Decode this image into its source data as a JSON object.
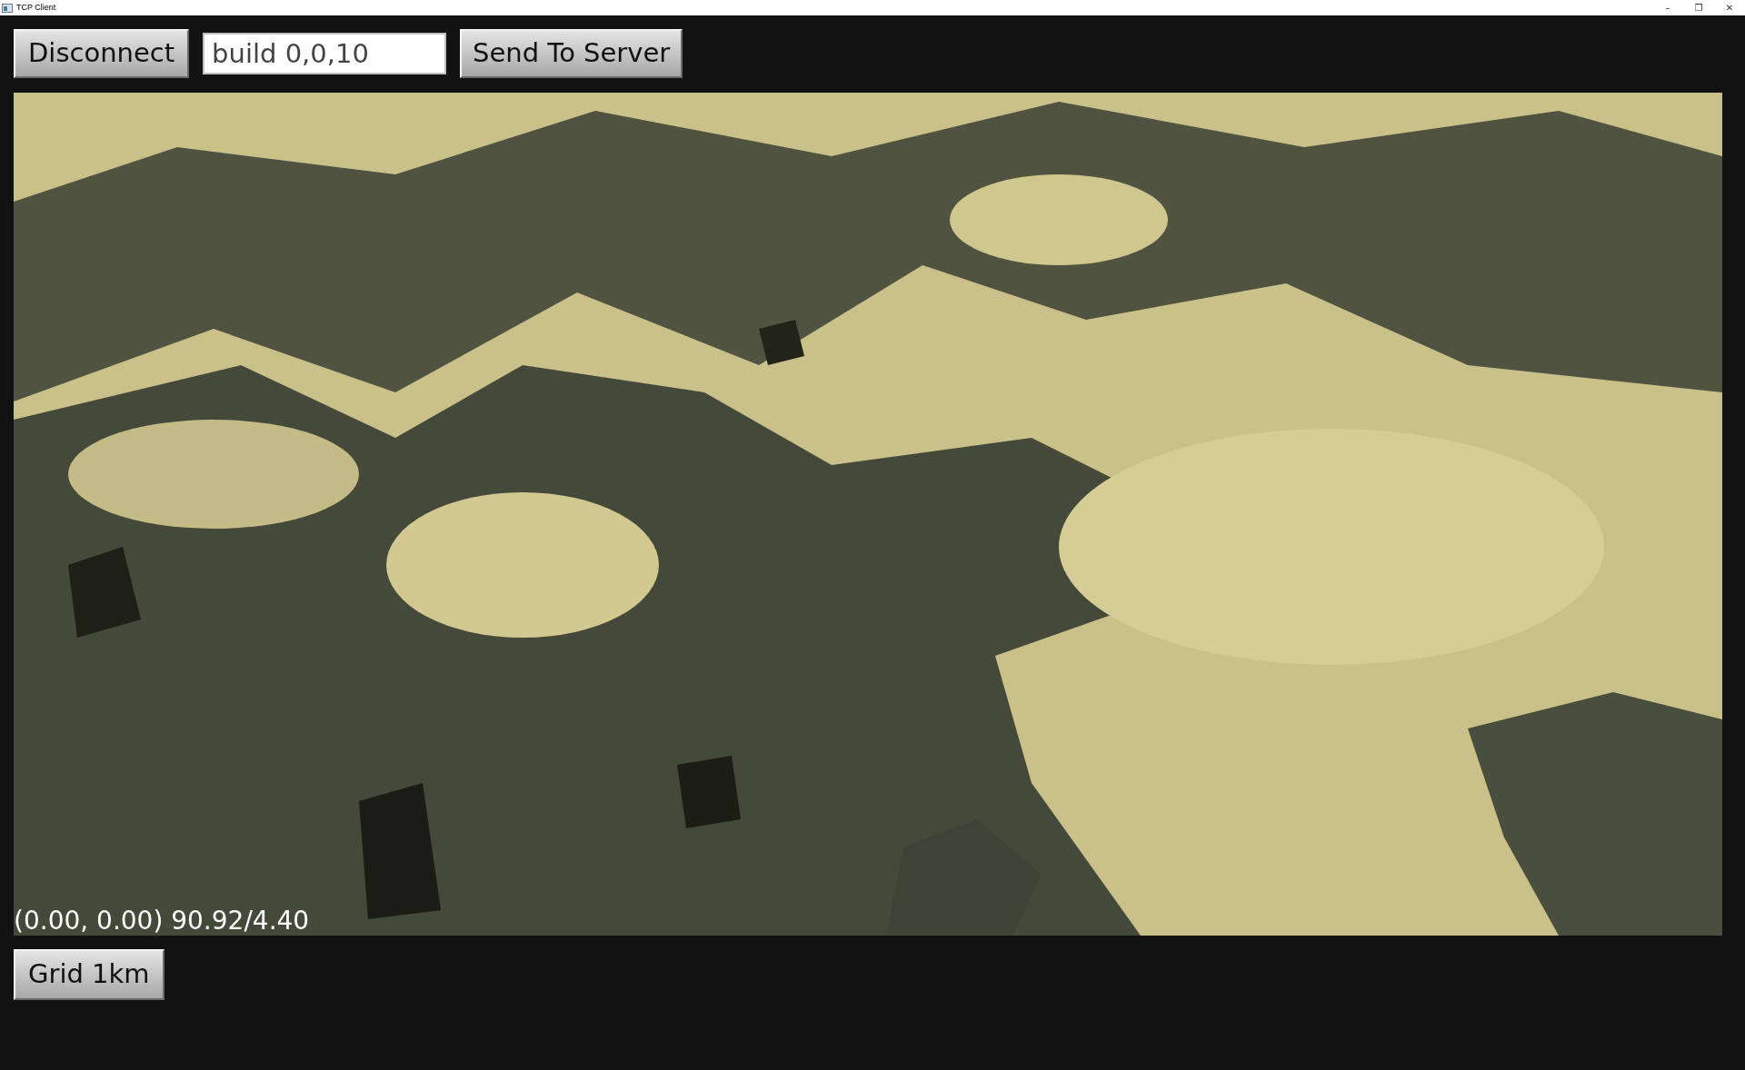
{
  "window": {
    "title": "TCP Client",
    "controls": [
      "–",
      "❐",
      "✕"
    ]
  },
  "toolbar": {
    "disconnect_button": "Disconnect",
    "command_field": {
      "value": "build 0,0,10"
    },
    "send_button": "Send To Server"
  },
  "viewport": {
    "overlay_text": "(0.00, 0.00) 90.92/4.40"
  },
  "bottom_bar": {
    "grid_button": "Grid 1km"
  }
}
